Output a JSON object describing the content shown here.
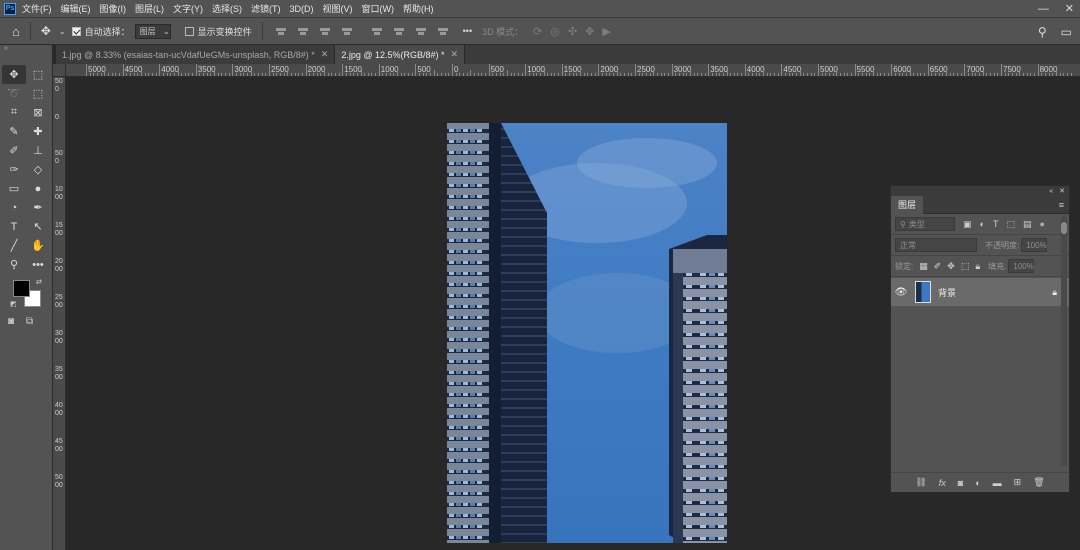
{
  "menubar": {
    "logo": "Ps",
    "items": [
      "文件(F)",
      "编辑(E)",
      "图像(I)",
      "图层(L)",
      "文字(Y)",
      "选择(S)",
      "滤镜(T)",
      "3D(D)",
      "视图(V)",
      "窗口(W)",
      "帮助(H)"
    ],
    "minimize_icon": "minimize-icon",
    "close_icon": "close-icon"
  },
  "options": {
    "home_icon": "home-icon",
    "move_icon": "move-icon",
    "auto_select_label": "自动选择：",
    "auto_select_checked": true,
    "auto_select_target": "图层",
    "show_transform_label": "显示变换控件",
    "show_transform_checked": false,
    "more_label": "•••",
    "mode_3d_label": "3D 模式：",
    "search_icon": "search-icon",
    "workspace_icon": "workspace-icon"
  },
  "tabs": [
    {
      "label": "1.jpg @ 8.33% (esaias-tan-ucVdafUeGMs-unsplash, RGB/8#) *",
      "active": false
    },
    {
      "label": "2.jpg @ 12.5%(RGB/8#) *",
      "active": true
    }
  ],
  "tools": [
    {
      "name": "move-tool",
      "glyph": "✥",
      "selected": true
    },
    {
      "name": "rect-marquee-tool",
      "glyph": "⬚"
    },
    {
      "name": "lasso-tool",
      "glyph": "➰"
    },
    {
      "name": "object-select-tool",
      "glyph": "⬚"
    },
    {
      "name": "crop-tool",
      "glyph": "⌗"
    },
    {
      "name": "frame-tool",
      "glyph": "⊠"
    },
    {
      "name": "eyedropper-tool",
      "glyph": "✎"
    },
    {
      "name": "healing-brush-tool",
      "glyph": "✚"
    },
    {
      "name": "brush-tool",
      "glyph": "✐"
    },
    {
      "name": "clone-stamp-tool",
      "glyph": "⊥"
    },
    {
      "name": "history-brush-tool",
      "glyph": "✑"
    },
    {
      "name": "eraser-tool",
      "glyph": "◇"
    },
    {
      "name": "gradient-tool",
      "glyph": "▭"
    },
    {
      "name": "blur-tool",
      "glyph": "●"
    },
    {
      "name": "dodge-tool",
      "glyph": "◔"
    },
    {
      "name": "pen-tool",
      "glyph": "✒"
    },
    {
      "name": "type-tool",
      "glyph": "T"
    },
    {
      "name": "path-select-tool",
      "glyph": "↖"
    },
    {
      "name": "line-tool",
      "glyph": "╱"
    },
    {
      "name": "hand-tool",
      "glyph": "✋"
    },
    {
      "name": "zoom-tool",
      "glyph": "⚲"
    },
    {
      "name": "more-tools",
      "glyph": "•••"
    }
  ],
  "ruler_top": [
    "5000",
    "4500",
    "4000",
    "3500",
    "3000",
    "2500",
    "2000",
    "1500",
    "1000",
    "500",
    "0",
    "500",
    "1000",
    "1500",
    "2000",
    "2500",
    "3000",
    "3500",
    "4000",
    "4500",
    "5000",
    "5500",
    "6000",
    "6500",
    "7000",
    "7500",
    "8000"
  ],
  "ruler_left": [
    "500",
    "0",
    "500",
    "1000",
    "1500",
    "2000",
    "2500",
    "3000",
    "3500",
    "4000",
    "4500",
    "5000"
  ],
  "layers_panel": {
    "title": "图层",
    "filter_placeholder": "类型",
    "blend_mode": "正常",
    "opacity_label": "不透明度:",
    "opacity_value": "100%",
    "lock_label": "锁定:",
    "fill_label": "填充:",
    "fill_value": "100%",
    "layers": [
      {
        "name": "背景",
        "visible": true,
        "locked": true
      }
    ],
    "bottom_icons": [
      "link-icon",
      "fx-icon",
      "mask-icon",
      "adjustment-icon",
      "folder-icon",
      "new-layer-icon",
      "trash-icon"
    ]
  },
  "colors": {
    "foreground": "#000000",
    "background": "#ffffff",
    "ui_dark": "#282828",
    "panel": "#535353"
  }
}
